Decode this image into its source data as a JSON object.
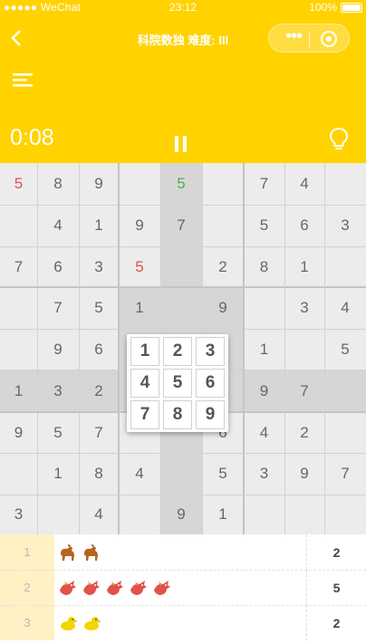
{
  "status_bar": {
    "carrier": "●●●●● WeChat",
    "time": "23:12",
    "battery": "100%"
  },
  "nav": {
    "title": "科院数独 难度: III",
    "more_label": "•••"
  },
  "game": {
    "timer": "0:08"
  },
  "icons": {
    "back": "back-arrow-icon",
    "menu": "hamburger-menu-icon",
    "close": "target-circle-icon",
    "pause": "pause-icon",
    "hint": "lightbulb-icon"
  },
  "colors": {
    "accent": "#ffd200",
    "given_digit": "#666666",
    "red_digit": "#e0524a",
    "green_digit": "#4caf50",
    "highlight": "#d6d6d6",
    "tally_index_bg": "#fff1c4"
  },
  "board": {
    "rows": [
      [
        "5",
        "8",
        "9",
        "",
        "5",
        "",
        "7",
        "4",
        ""
      ],
      [
        "",
        "4",
        "1",
        "9",
        "7",
        "",
        "5",
        "6",
        "3"
      ],
      [
        "7",
        "6",
        "3",
        "5",
        "",
        "2",
        "8",
        "1",
        ""
      ],
      [
        "",
        "7",
        "5",
        "1",
        "",
        "9",
        "",
        "3",
        "4"
      ],
      [
        "",
        "9",
        "6",
        "",
        "",
        "",
        "1",
        "",
        "5"
      ],
      [
        "1",
        "3",
        "2",
        "",
        "",
        "",
        "9",
        "7",
        ""
      ],
      [
        "9",
        "5",
        "7",
        "",
        "",
        "6",
        "4",
        "2",
        ""
      ],
      [
        "",
        "1",
        "8",
        "4",
        "",
        "5",
        "3",
        "9",
        "7"
      ],
      [
        "3",
        "",
        "4",
        "",
        "9",
        "1",
        "",
        "",
        ""
      ]
    ],
    "red_cells": [
      [
        0,
        0
      ],
      [
        2,
        3
      ]
    ],
    "green_cells": [
      [
        0,
        4
      ]
    ]
  },
  "numpad": {
    "keys": [
      "1",
      "2",
      "3",
      "4",
      "5",
      "6",
      "7",
      "8",
      "9"
    ]
  },
  "tally": [
    {
      "index": "1",
      "creature": "horse-icon",
      "count": "2",
      "icon_count": 2,
      "color": "#b5651d"
    },
    {
      "index": "2",
      "creature": "dragon-icon",
      "count": "5",
      "icon_count": 5,
      "color": "#e0524a"
    },
    {
      "index": "3",
      "creature": "duck-icon",
      "count": "2",
      "icon_count": 2,
      "color": "#f2d600"
    }
  ]
}
